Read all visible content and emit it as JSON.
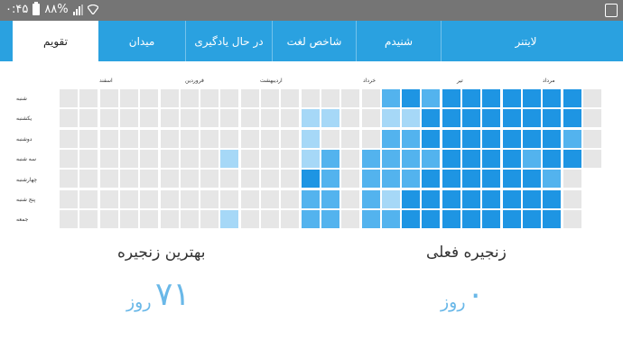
{
  "statusbar": {
    "time": "۰:۴۵",
    "battery": "۸۸%"
  },
  "tabs": [
    {
      "label": "تقویم",
      "active": true
    },
    {
      "label": "میدان",
      "active": false
    },
    {
      "label": "در حال یادگیری",
      "active": false
    },
    {
      "label": "شاخص لغت",
      "active": false
    },
    {
      "label": "شنیدم",
      "active": false
    },
    {
      "label": "لایتنر",
      "active": false
    }
  ],
  "calendar": {
    "months": [
      "اسفند",
      "فروردین",
      "اردیبهشت",
      "خرداد",
      "تیر",
      "مرداد"
    ],
    "days": [
      "شنبه",
      "یکشنبه",
      "دوشنبه",
      "سه شنبه",
      "چهارشنبه",
      "پنج شنبه",
      "جمعه"
    ],
    "levels": [
      [
        0,
        0,
        0,
        0,
        0,
        0,
        0,
        0,
        0,
        0,
        0,
        0,
        0,
        0,
        0,
        0,
        2,
        3,
        2,
        3,
        3,
        3,
        3,
        3,
        3,
        3,
        0
      ],
      [
        0,
        0,
        0,
        0,
        0,
        0,
        0,
        0,
        0,
        0,
        0,
        0,
        1,
        1,
        0,
        0,
        1,
        1,
        3,
        3,
        3,
        3,
        3,
        3,
        3,
        3,
        0
      ],
      [
        0,
        0,
        0,
        0,
        0,
        0,
        0,
        0,
        0,
        0,
        0,
        0,
        1,
        0,
        0,
        0,
        2,
        2,
        3,
        3,
        3,
        3,
        3,
        3,
        3,
        2,
        0
      ],
      [
        0,
        0,
        0,
        0,
        0,
        0,
        0,
        0,
        1,
        0,
        0,
        0,
        1,
        2,
        0,
        2,
        2,
        2,
        2,
        3,
        3,
        3,
        3,
        2,
        3,
        3,
        0
      ],
      [
        0,
        0,
        0,
        0,
        0,
        0,
        0,
        0,
        0,
        0,
        0,
        0,
        3,
        2,
        0,
        2,
        2,
        2,
        3,
        3,
        3,
        3,
        3,
        3,
        2,
        0,
        -1
      ],
      [
        0,
        0,
        0,
        0,
        0,
        0,
        0,
        0,
        0,
        0,
        0,
        0,
        2,
        2,
        0,
        2,
        1,
        3,
        3,
        3,
        3,
        3,
        3,
        3,
        3,
        0,
        -1
      ],
      [
        0,
        0,
        0,
        0,
        0,
        0,
        0,
        0,
        1,
        0,
        0,
        0,
        2,
        2,
        0,
        2,
        2,
        3,
        3,
        3,
        3,
        3,
        3,
        3,
        3,
        0,
        -1
      ]
    ],
    "colors": [
      "#e6e6e6",
      "#a6d8f7",
      "#53b3ee",
      "#1e95e3"
    ]
  },
  "stats": {
    "current": {
      "title": "زنجیره فعلی",
      "value": "۰",
      "unit": "روز"
    },
    "best": {
      "title": "بهترین زنجیره",
      "value": "۷۱",
      "unit": "روز"
    }
  }
}
